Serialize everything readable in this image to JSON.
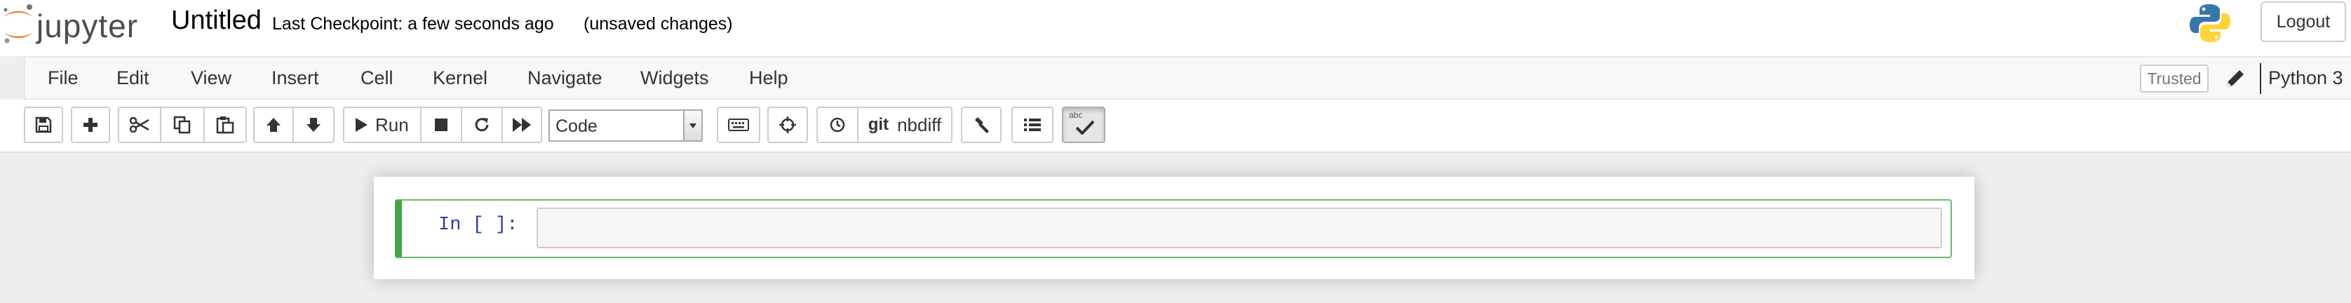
{
  "header": {
    "logo_text": "jupyter",
    "notebook_title": "Untitled",
    "checkpoint": "Last Checkpoint: a few seconds ago",
    "save_status": "(unsaved changes)",
    "logout_label": "Logout"
  },
  "menubar": {
    "items": [
      {
        "label": "File"
      },
      {
        "label": "Edit"
      },
      {
        "label": "View"
      },
      {
        "label": "Insert"
      },
      {
        "label": "Cell"
      },
      {
        "label": "Kernel"
      },
      {
        "label": "Navigate"
      },
      {
        "label": "Widgets"
      },
      {
        "label": "Help"
      }
    ],
    "trusted_label": "Trusted",
    "kernel_name": "Python 3"
  },
  "toolbar": {
    "run_label": "Run",
    "cell_type": "Code",
    "git_label": "git",
    "nbdiff_label": "nbdiff",
    "spell_label": "abc"
  },
  "cell": {
    "prompt": "In [ ]:",
    "source": ""
  },
  "colors": {
    "selected_cell_border": "#42a54b",
    "prompt_color": "#303f9f",
    "jupyter_orange": "#f37726"
  }
}
